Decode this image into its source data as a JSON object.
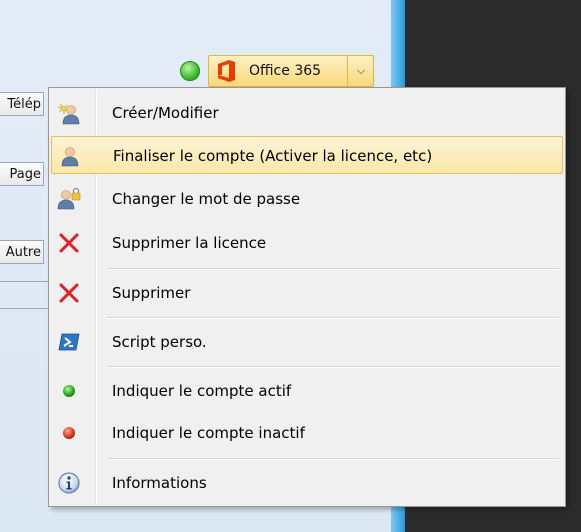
{
  "background": {
    "side_buttons": [
      "Télép",
      "Page",
      "Autre"
    ]
  },
  "status": {
    "icon": "green-status-dot"
  },
  "office_button": {
    "label": "Office 365",
    "icon": "office-logo-icon",
    "arrow": "⌵"
  },
  "menu": {
    "items": [
      {
        "label": "Créer/Modifier",
        "icon": "user-new-icon"
      },
      {
        "label": "Finaliser le compte (Activer la licence, etc)",
        "icon": "user-icon",
        "highlighted": true
      },
      {
        "label": "Changer le mot de passe",
        "icon": "user-key-icon"
      },
      {
        "label": "Supprimer la licence",
        "icon": "red-x-icon"
      },
      {
        "label": "Supprimer",
        "icon": "red-x-icon"
      },
      {
        "label": "Script perso.",
        "icon": "powershell-icon"
      },
      {
        "label": "Indiquer le compte actif",
        "icon": "green-dot-icon"
      },
      {
        "label": "Indiquer le compte inactif",
        "icon": "red-dot-icon"
      },
      {
        "label": "Informations",
        "icon": "info-icon"
      }
    ]
  },
  "colors": {
    "highlight": "#fbe7a8",
    "accent_blue": "#49aee6",
    "dark": "#2b2b2b"
  }
}
